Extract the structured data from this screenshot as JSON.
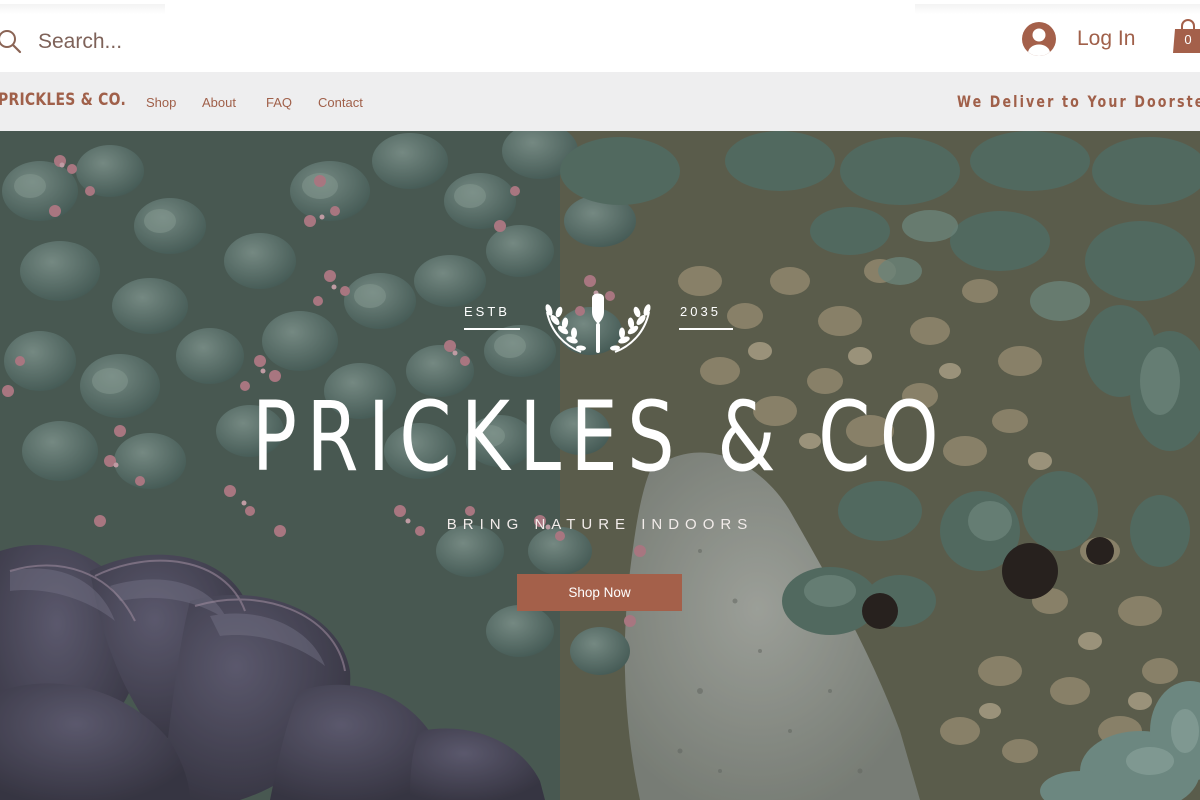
{
  "search": {
    "placeholder": "Search..."
  },
  "account": {
    "login_label": "Log In"
  },
  "cart": {
    "count": "0"
  },
  "nav": {
    "brand": "PRICKLES & CO.",
    "items": [
      {
        "label": "Shop"
      },
      {
        "label": "About"
      },
      {
        "label": "FAQ"
      },
      {
        "label": "Contact"
      }
    ],
    "tagline": "We Deliver to Your Doorstep"
  },
  "hero": {
    "estb_label": "ESTB",
    "estb_year": "2035",
    "title": "PRICKLES & CO",
    "subtitle": "BRING NATURE INDOORS",
    "cta_label": "Shop Now"
  },
  "colors": {
    "accent": "#a4604a",
    "navbar_bg": "#eeeeef",
    "text_brown": "#a0604a"
  },
  "icons": [
    "search-icon",
    "user-avatar-icon",
    "shopping-bag-icon",
    "shovel-laurel-emblem-icon"
  ]
}
